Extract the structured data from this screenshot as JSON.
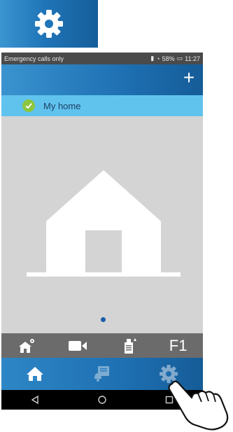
{
  "status_bar": {
    "carrier": "Emergency calls only",
    "battery": "58%",
    "time": "11:27"
  },
  "app_bar": {
    "add_symbol": "+"
  },
  "home_list": {
    "items": [
      {
        "label": "My home",
        "selected": true
      }
    ]
  },
  "pager": {
    "pages": 1,
    "current": 1
  },
  "action_bar": {
    "items": [
      "house-settings-icon",
      "video-camera-icon",
      "door-station-icon"
    ],
    "f1_label": "F1"
  },
  "tab_bar": {
    "tabs": [
      {
        "icon": "home-icon",
        "active": false
      },
      {
        "icon": "notifications-icon",
        "active": false
      },
      {
        "icon": "settings-icon",
        "active": true
      }
    ]
  },
  "colors": {
    "brand_blue": "#1e70b2",
    "list_highlight": "#5fc3ee",
    "check_green": "#8cc63f"
  }
}
